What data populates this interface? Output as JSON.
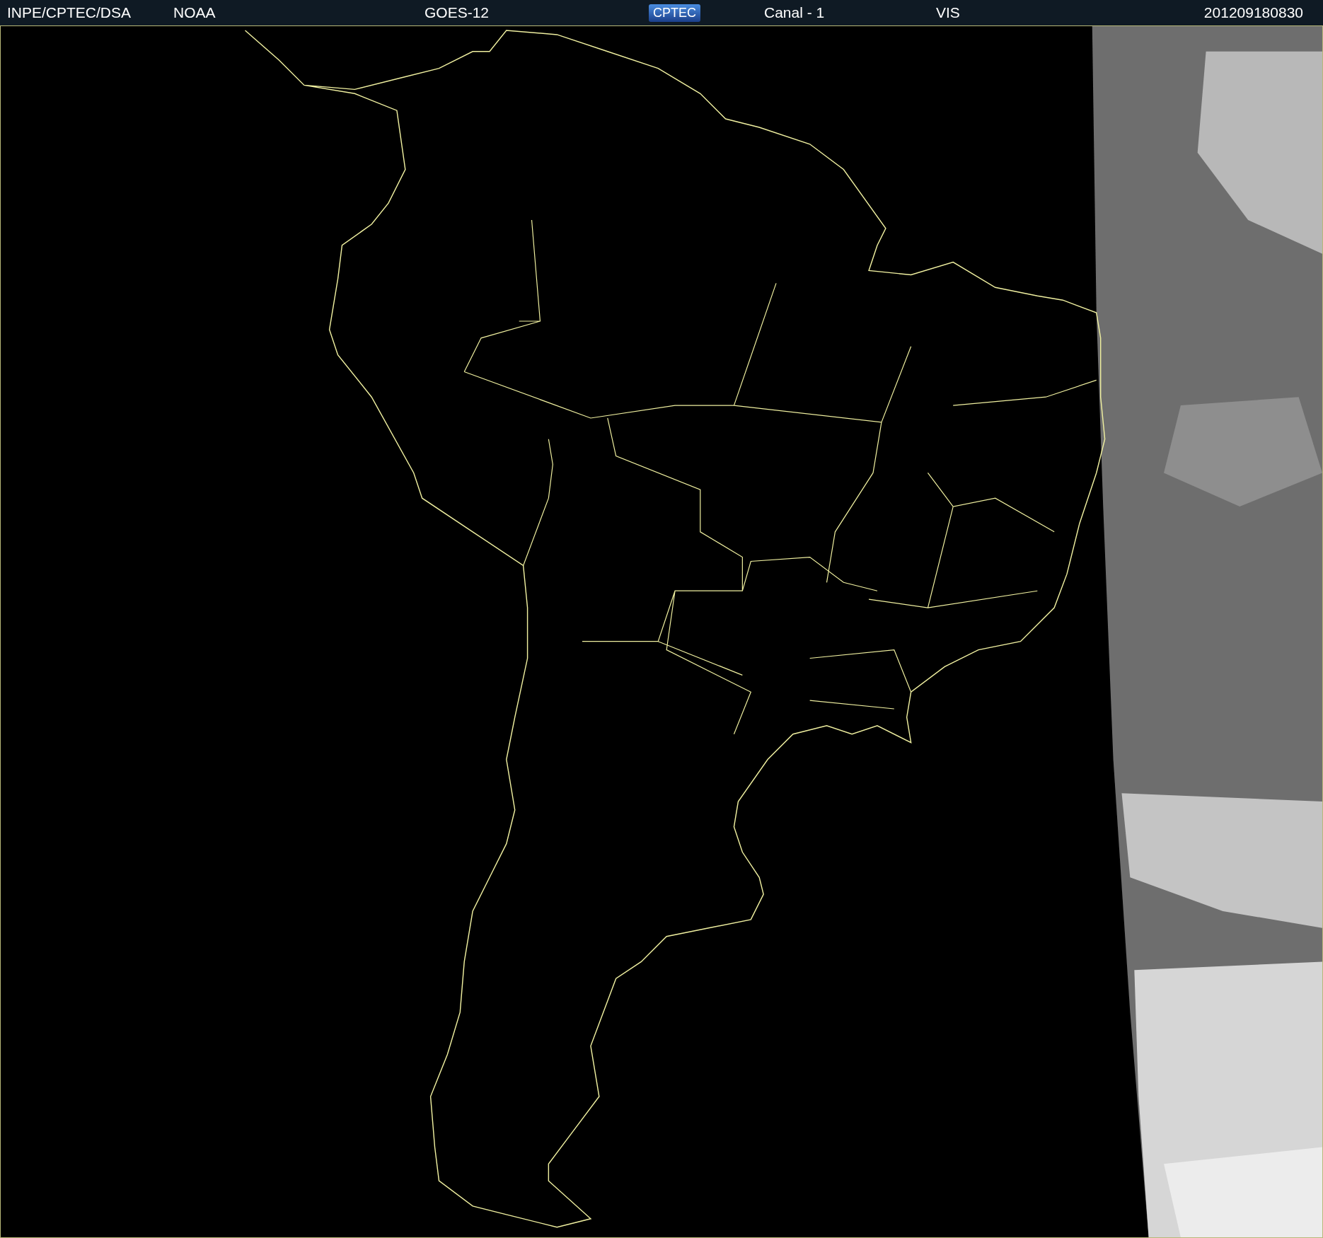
{
  "header": {
    "items": [
      {
        "kind": "text",
        "text": "INPE/CPTEC/DSA"
      },
      {
        "kind": "text",
        "text": "NOAA"
      },
      {
        "kind": "text",
        "text": "GOES-12"
      },
      {
        "kind": "logo",
        "text": "CPTEC"
      },
      {
        "kind": "text",
        "text": "Canal - 1"
      },
      {
        "kind": "text",
        "text": "VIS"
      },
      {
        "kind": "text",
        "text": "201209180830"
      }
    ]
  }
}
